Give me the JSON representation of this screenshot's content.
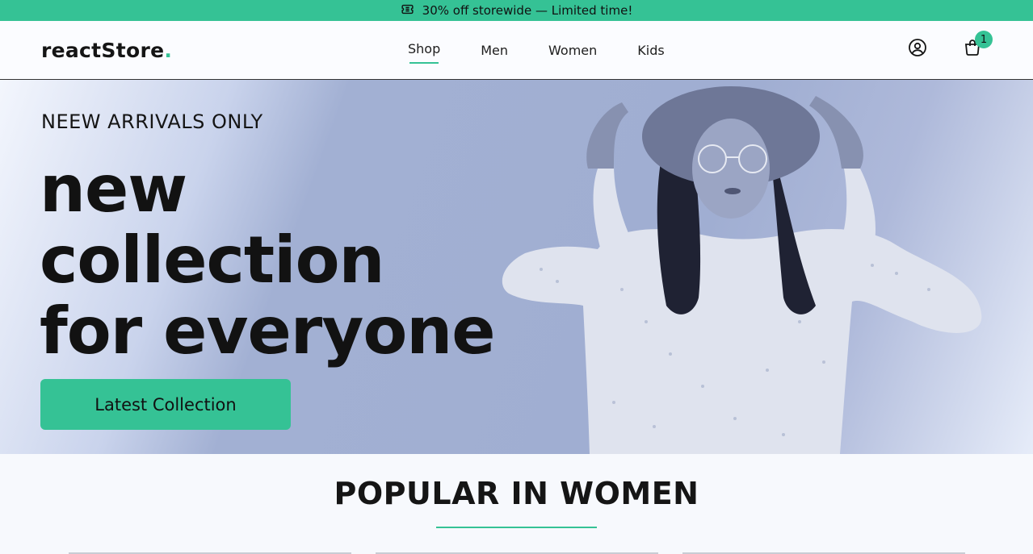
{
  "promo": {
    "text": "30% off storewide — Limited time!",
    "icon": "ticket-icon"
  },
  "header": {
    "logo": "reactStore",
    "logo_dot": ".",
    "nav": [
      {
        "label": "Shop",
        "active": true
      },
      {
        "label": "Men",
        "active": false
      },
      {
        "label": "Women",
        "active": false
      },
      {
        "label": "Kids",
        "active": false
      }
    ],
    "account_icon": "user-circle-icon",
    "cart_icon": "shopping-bag-icon",
    "cart_count": "1"
  },
  "hero": {
    "kicker": "NEEW ARRIVALS ONLY",
    "headline_line1": "new",
    "headline_line2": "collection",
    "headline_line3": "for everyone",
    "cta_label": "Latest Collection"
  },
  "popular": {
    "title": "POPULAR IN WOMEN"
  },
  "colors": {
    "accent": "#35c295",
    "hero_bg": "#a2b0d3"
  }
}
